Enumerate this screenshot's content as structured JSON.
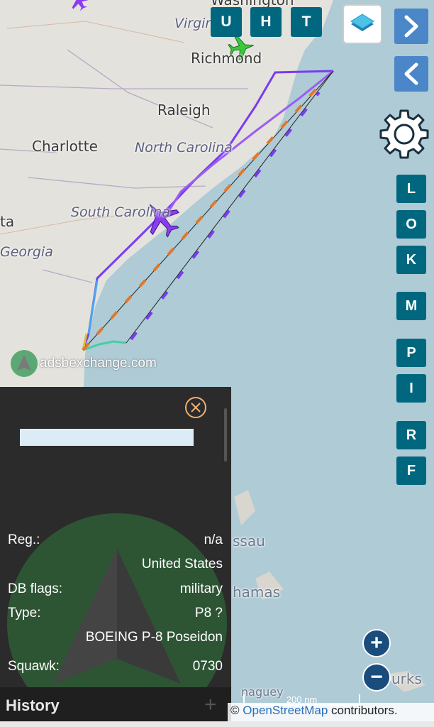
{
  "map": {
    "place_labels": [
      "Washington",
      "Virginia",
      "Richmond",
      "Raleigh",
      "Charlotte",
      "North Carolina",
      "South Carolina",
      "ta",
      "Georgia",
      "ssau",
      "hamas",
      "urks",
      "naguey"
    ],
    "watermark": "adsbexchange.com",
    "colors": {
      "land": "#e4e2dc",
      "water": "#aecbd6",
      "track_purple": "#7a3cf0",
      "track_orange": "#e07828",
      "selected_plane": "#8b3cf0",
      "other_plane": "#3cc83c"
    }
  },
  "top_buttons": [
    "U",
    "H",
    "T"
  ],
  "layers_button": {
    "icon": "layers-icon"
  },
  "nav": {
    "forward_icon": "chevron-right-icon",
    "back_icon": "chevron-left-icon"
  },
  "settings": {
    "icon": "gear-icon"
  },
  "side_buttons": [
    "L",
    "O",
    "K",
    "M",
    "P",
    "I",
    "R",
    "F"
  ],
  "info_panel": {
    "close_icon": "close-circle-icon",
    "callsign_value": "",
    "rows": [
      {
        "key": "Reg.:",
        "value": "n/a"
      },
      {
        "key": "",
        "value": "United States"
      },
      {
        "key": "DB flags:",
        "value": "military"
      },
      {
        "key": "Type:",
        "value": "P8 ?"
      },
      {
        "key": "",
        "value": "BOEING P-8 Poseidon"
      },
      {
        "key": "Squawk:",
        "value": "0730"
      }
    ],
    "history_label": "History",
    "history_plus": "+"
  },
  "zoom": {
    "in": "+",
    "out": "−"
  },
  "scale": "200 nm",
  "attribution": {
    "prefix": "©",
    "link": "OpenStreetMap",
    "suffix": " contributors."
  }
}
